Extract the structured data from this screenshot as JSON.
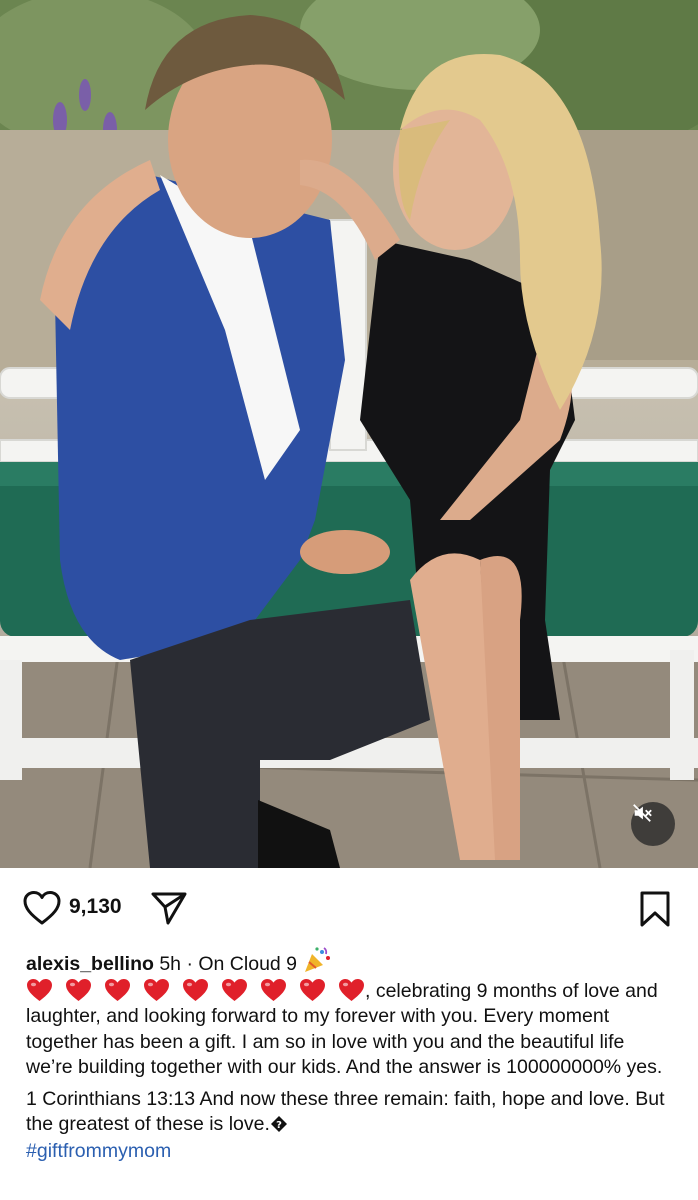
{
  "post": {
    "media": {
      "description_icon": "mute-icon"
    },
    "actions": {
      "like_icon": "heart-outline-icon",
      "like_count": "9,130",
      "share_icon": "paper-plane-icon",
      "save_icon": "bookmark-icon"
    },
    "caption": {
      "username": "alexis_bellino",
      "time": "5h",
      "separator": "·",
      "audio": "On Cloud 9",
      "audio_icon": "party-popper-icon",
      "heart_emoji_count": 9,
      "heart_color": "#e0202a",
      "text_after_hearts": ", celebrating 9 months of love and laughter, and looking forward to my forever with you. Every moment together has been a gift.  I am so in love with you and the beautiful life we’re building together with our kids. And the answer is 100000000% yes.",
      "verse": "1 Corinthians 13:13 And now these three remain: faith, hope and love. But the greatest of these is love.",
      "verse_trailing_icon": "unknown-glyph-icon",
      "hashtag": "#giftfrommymom",
      "hashtag_color": "#2b5fb0"
    }
  }
}
